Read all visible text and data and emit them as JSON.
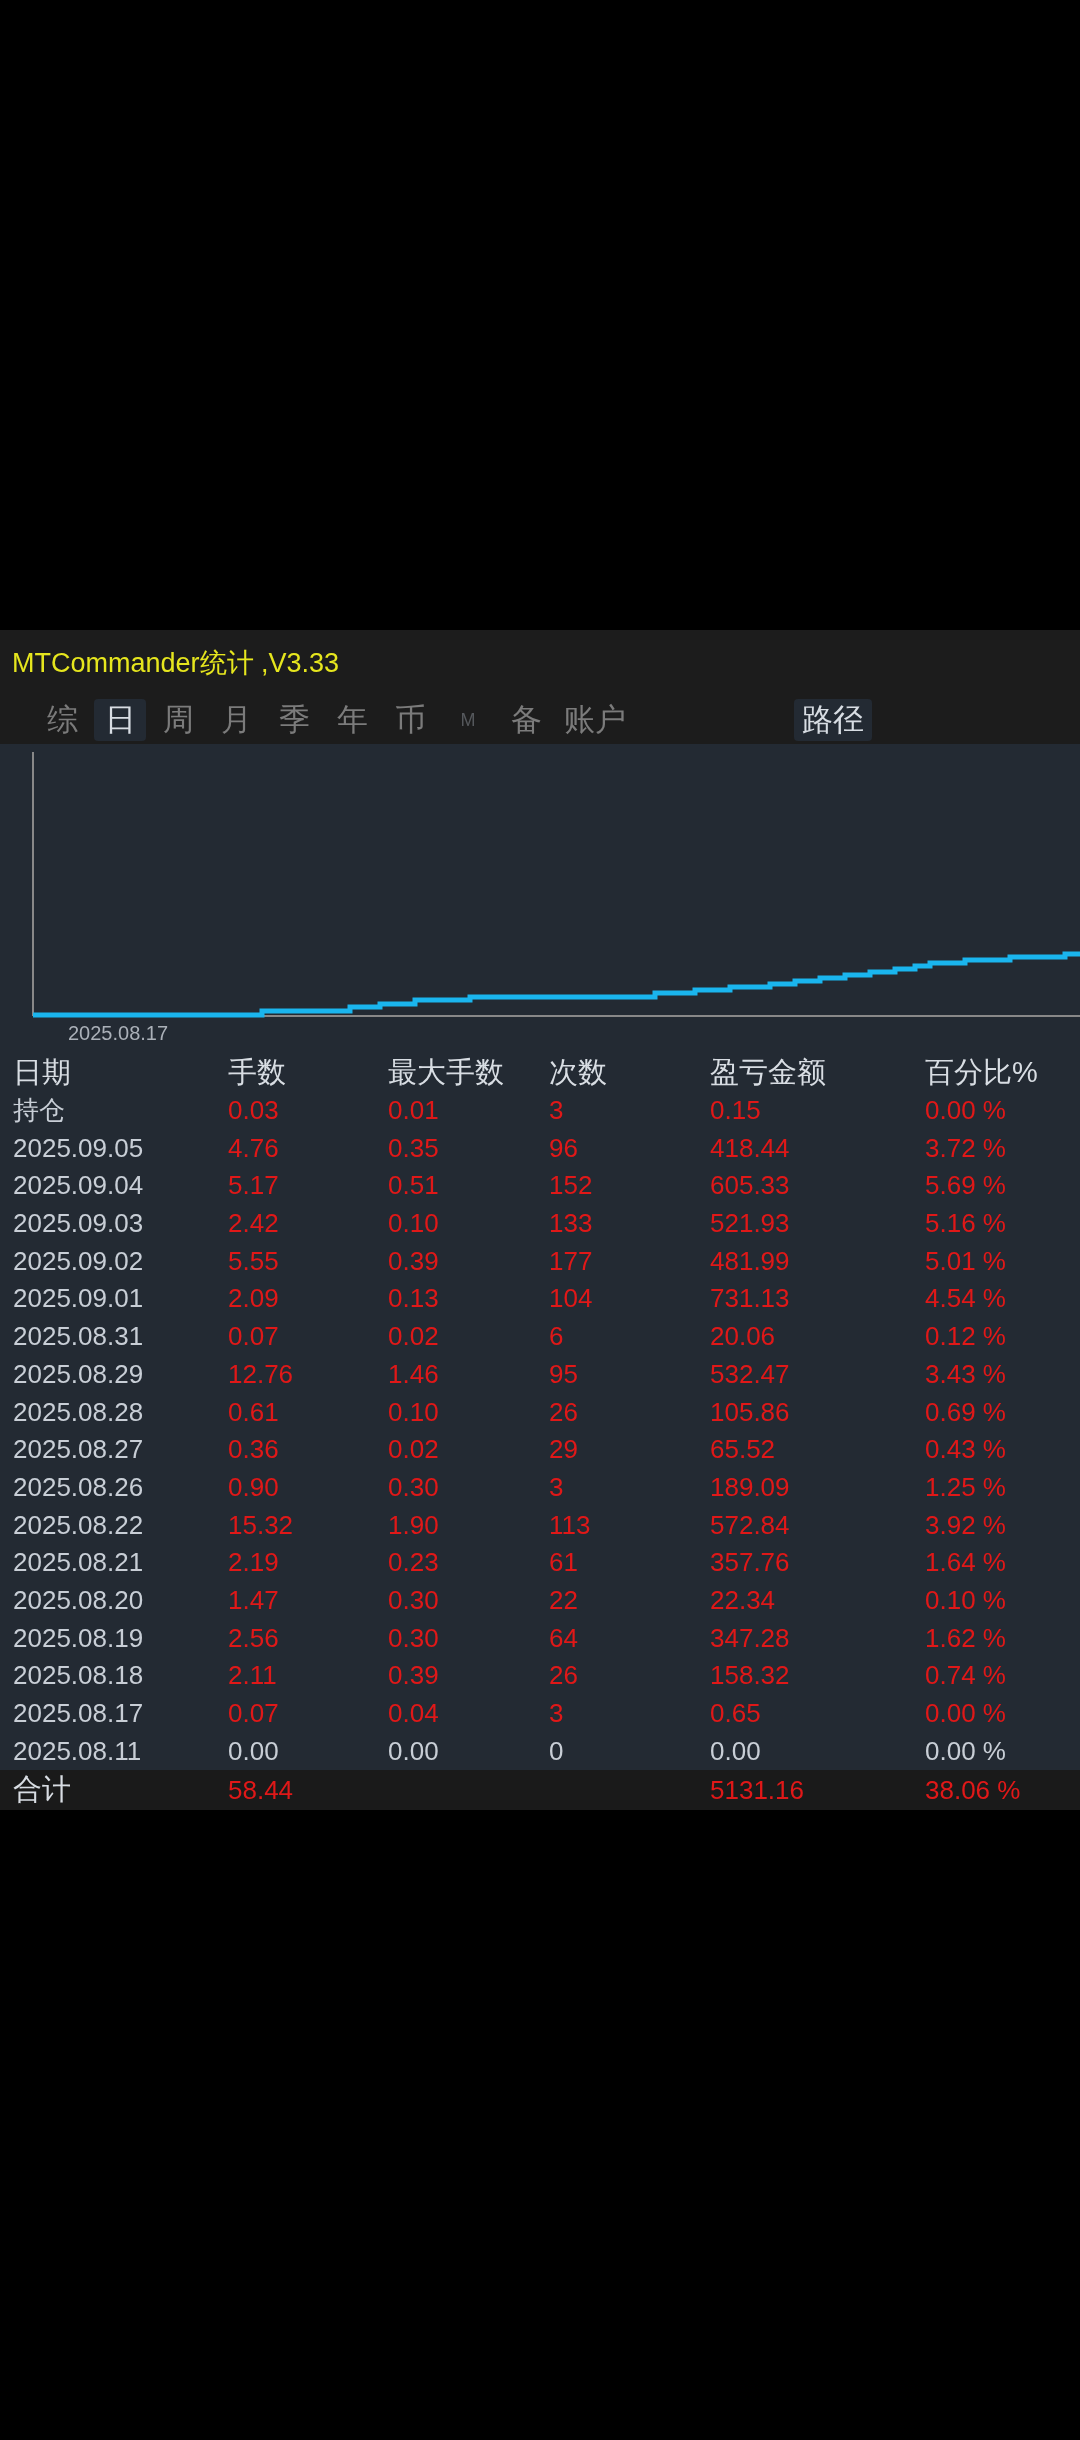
{
  "header": {
    "title": "MTCommander统计 ,V3.33"
  },
  "tabs": [
    {
      "label": "综",
      "selected": false,
      "disabled": false
    },
    {
      "label": "日",
      "selected": true,
      "disabled": false
    },
    {
      "label": "周",
      "selected": false,
      "disabled": false
    },
    {
      "label": "月",
      "selected": false,
      "disabled": false
    },
    {
      "label": "季",
      "selected": false,
      "disabled": false
    },
    {
      "label": "年",
      "selected": false,
      "disabled": false
    },
    {
      "label": "币",
      "selected": false,
      "disabled": false
    },
    {
      "label": "M",
      "selected": false,
      "disabled": true
    },
    {
      "label": "备",
      "selected": false,
      "disabled": false
    },
    {
      "label": "账户",
      "selected": false,
      "disabled": false
    }
  ],
  "path_button": {
    "label": "路径"
  },
  "chart": {
    "x_label": "2025.08.17"
  },
  "table": {
    "columns": [
      "日期",
      "手数",
      "最大手数",
      "次数",
      "盈亏金额",
      "百分比%"
    ],
    "rows": [
      {
        "kind": "gain",
        "cells": [
          "持仓",
          "0.03",
          "0.01",
          "3",
          "0.15",
          "0.00 %"
        ]
      },
      {
        "kind": "gain",
        "cells": [
          "2025.09.05",
          "4.76",
          "0.35",
          "96",
          "418.44",
          "3.72 %"
        ]
      },
      {
        "kind": "gain",
        "cells": [
          "2025.09.04",
          "5.17",
          "0.51",
          "152",
          "605.33",
          "5.69 %"
        ]
      },
      {
        "kind": "gain",
        "cells": [
          "2025.09.03",
          "2.42",
          "0.10",
          "133",
          "521.93",
          "5.16 %"
        ]
      },
      {
        "kind": "gain",
        "cells": [
          "2025.09.02",
          "5.55",
          "0.39",
          "177",
          "481.99",
          "5.01 %"
        ]
      },
      {
        "kind": "gain",
        "cells": [
          "2025.09.01",
          "2.09",
          "0.13",
          "104",
          "731.13",
          "4.54 %"
        ]
      },
      {
        "kind": "gain",
        "cells": [
          "2025.08.31",
          "0.07",
          "0.02",
          "6",
          "20.06",
          "0.12 %"
        ]
      },
      {
        "kind": "gain",
        "cells": [
          "2025.08.29",
          "12.76",
          "1.46",
          "95",
          "532.47",
          "3.43 %"
        ]
      },
      {
        "kind": "gain",
        "cells": [
          "2025.08.28",
          "0.61",
          "0.10",
          "26",
          "105.86",
          "0.69 %"
        ]
      },
      {
        "kind": "gain",
        "cells": [
          "2025.08.27",
          "0.36",
          "0.02",
          "29",
          "65.52",
          "0.43 %"
        ]
      },
      {
        "kind": "gain",
        "cells": [
          "2025.08.26",
          "0.90",
          "0.30",
          "3",
          "189.09",
          "1.25 %"
        ]
      },
      {
        "kind": "gain",
        "cells": [
          "2025.08.22",
          "15.32",
          "1.90",
          "113",
          "572.84",
          "3.92 %"
        ]
      },
      {
        "kind": "gain",
        "cells": [
          "2025.08.21",
          "2.19",
          "0.23",
          "61",
          "357.76",
          "1.64 %"
        ]
      },
      {
        "kind": "gain",
        "cells": [
          "2025.08.20",
          "1.47",
          "0.30",
          "22",
          "22.34",
          "0.10 %"
        ]
      },
      {
        "kind": "gain",
        "cells": [
          "2025.08.19",
          "2.56",
          "0.30",
          "64",
          "347.28",
          "1.62 %"
        ]
      },
      {
        "kind": "gain",
        "cells": [
          "2025.08.18",
          "2.11",
          "0.39",
          "26",
          "158.32",
          "0.74 %"
        ]
      },
      {
        "kind": "gain",
        "cells": [
          "2025.08.17",
          "0.07",
          "0.04",
          "3",
          "0.65",
          "0.00 %"
        ]
      },
      {
        "kind": "zero",
        "cells": [
          "2025.08.11",
          "0.00",
          "0.00",
          "0",
          "0.00",
          "0.00 %"
        ]
      }
    ],
    "total": {
      "label": "合计",
      "lots": "58.44",
      "profit": "5131.16",
      "percent": "38.06 %"
    }
  }
}
